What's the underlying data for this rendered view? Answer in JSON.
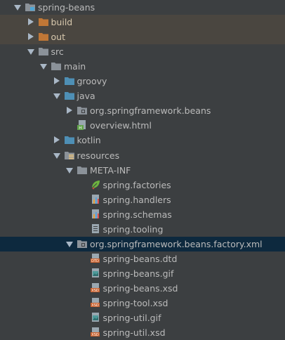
{
  "colors": {
    "background": "#3c3f41",
    "selected_row": "#0d293e",
    "excluded_row": "#4a4640",
    "folder_brown": "#c07736",
    "folder_blue": "#4e8fb5",
    "folder_gray": "#8b9299"
  },
  "tree": {
    "items": [
      {
        "label": "spring-beans",
        "depth": 0,
        "expanded": true,
        "icon": "module-folder-icon"
      },
      {
        "label": "build",
        "depth": 1,
        "expanded": false,
        "icon": "excluded-folder-icon"
      },
      {
        "label": "out",
        "depth": 1,
        "expanded": false,
        "icon": "excluded-folder-icon"
      },
      {
        "label": "src",
        "depth": 1,
        "expanded": true,
        "icon": "folder-icon"
      },
      {
        "label": "main",
        "depth": 2,
        "expanded": true,
        "icon": "folder-icon"
      },
      {
        "label": "groovy",
        "depth": 3,
        "expanded": false,
        "icon": "source-folder-icon"
      },
      {
        "label": "java",
        "depth": 3,
        "expanded": true,
        "icon": "source-folder-icon"
      },
      {
        "label": "org.springframework.beans",
        "depth": 4,
        "expanded": false,
        "icon": "package-icon"
      },
      {
        "label": "overview.html",
        "depth": 4,
        "icon": "html-file-icon"
      },
      {
        "label": "kotlin",
        "depth": 3,
        "expanded": false,
        "icon": "source-folder-icon"
      },
      {
        "label": "resources",
        "depth": 3,
        "expanded": true,
        "icon": "resources-folder-icon"
      },
      {
        "label": "META-INF",
        "depth": 4,
        "expanded": true,
        "icon": "folder-icon"
      },
      {
        "label": "spring.factories",
        "depth": 5,
        "icon": "spring-leaf-icon"
      },
      {
        "label": "spring.handlers",
        "depth": 5,
        "icon": "properties-file-icon"
      },
      {
        "label": "spring.schemas",
        "depth": 5,
        "icon": "properties-file-icon"
      },
      {
        "label": "spring.tooling",
        "depth": 5,
        "icon": "text-file-icon"
      },
      {
        "label": "org.springframework.beans.factory.xml",
        "depth": 4,
        "expanded": true,
        "icon": "package-icon",
        "selected": true
      },
      {
        "label": "spring-beans.dtd",
        "depth": 5,
        "icon": "dtd-file-icon"
      },
      {
        "label": "spring-beans.gif",
        "depth": 5,
        "icon": "image-file-icon"
      },
      {
        "label": "spring-beans.xsd",
        "depth": 5,
        "icon": "xsd-file-icon"
      },
      {
        "label": "spring-tool.xsd",
        "depth": 5,
        "icon": "xsd-file-icon"
      },
      {
        "label": "spring-util.gif",
        "depth": 5,
        "icon": "image-file-icon"
      },
      {
        "label": "spring-util.xsd",
        "depth": 5,
        "icon": "xsd-file-icon"
      }
    ]
  }
}
